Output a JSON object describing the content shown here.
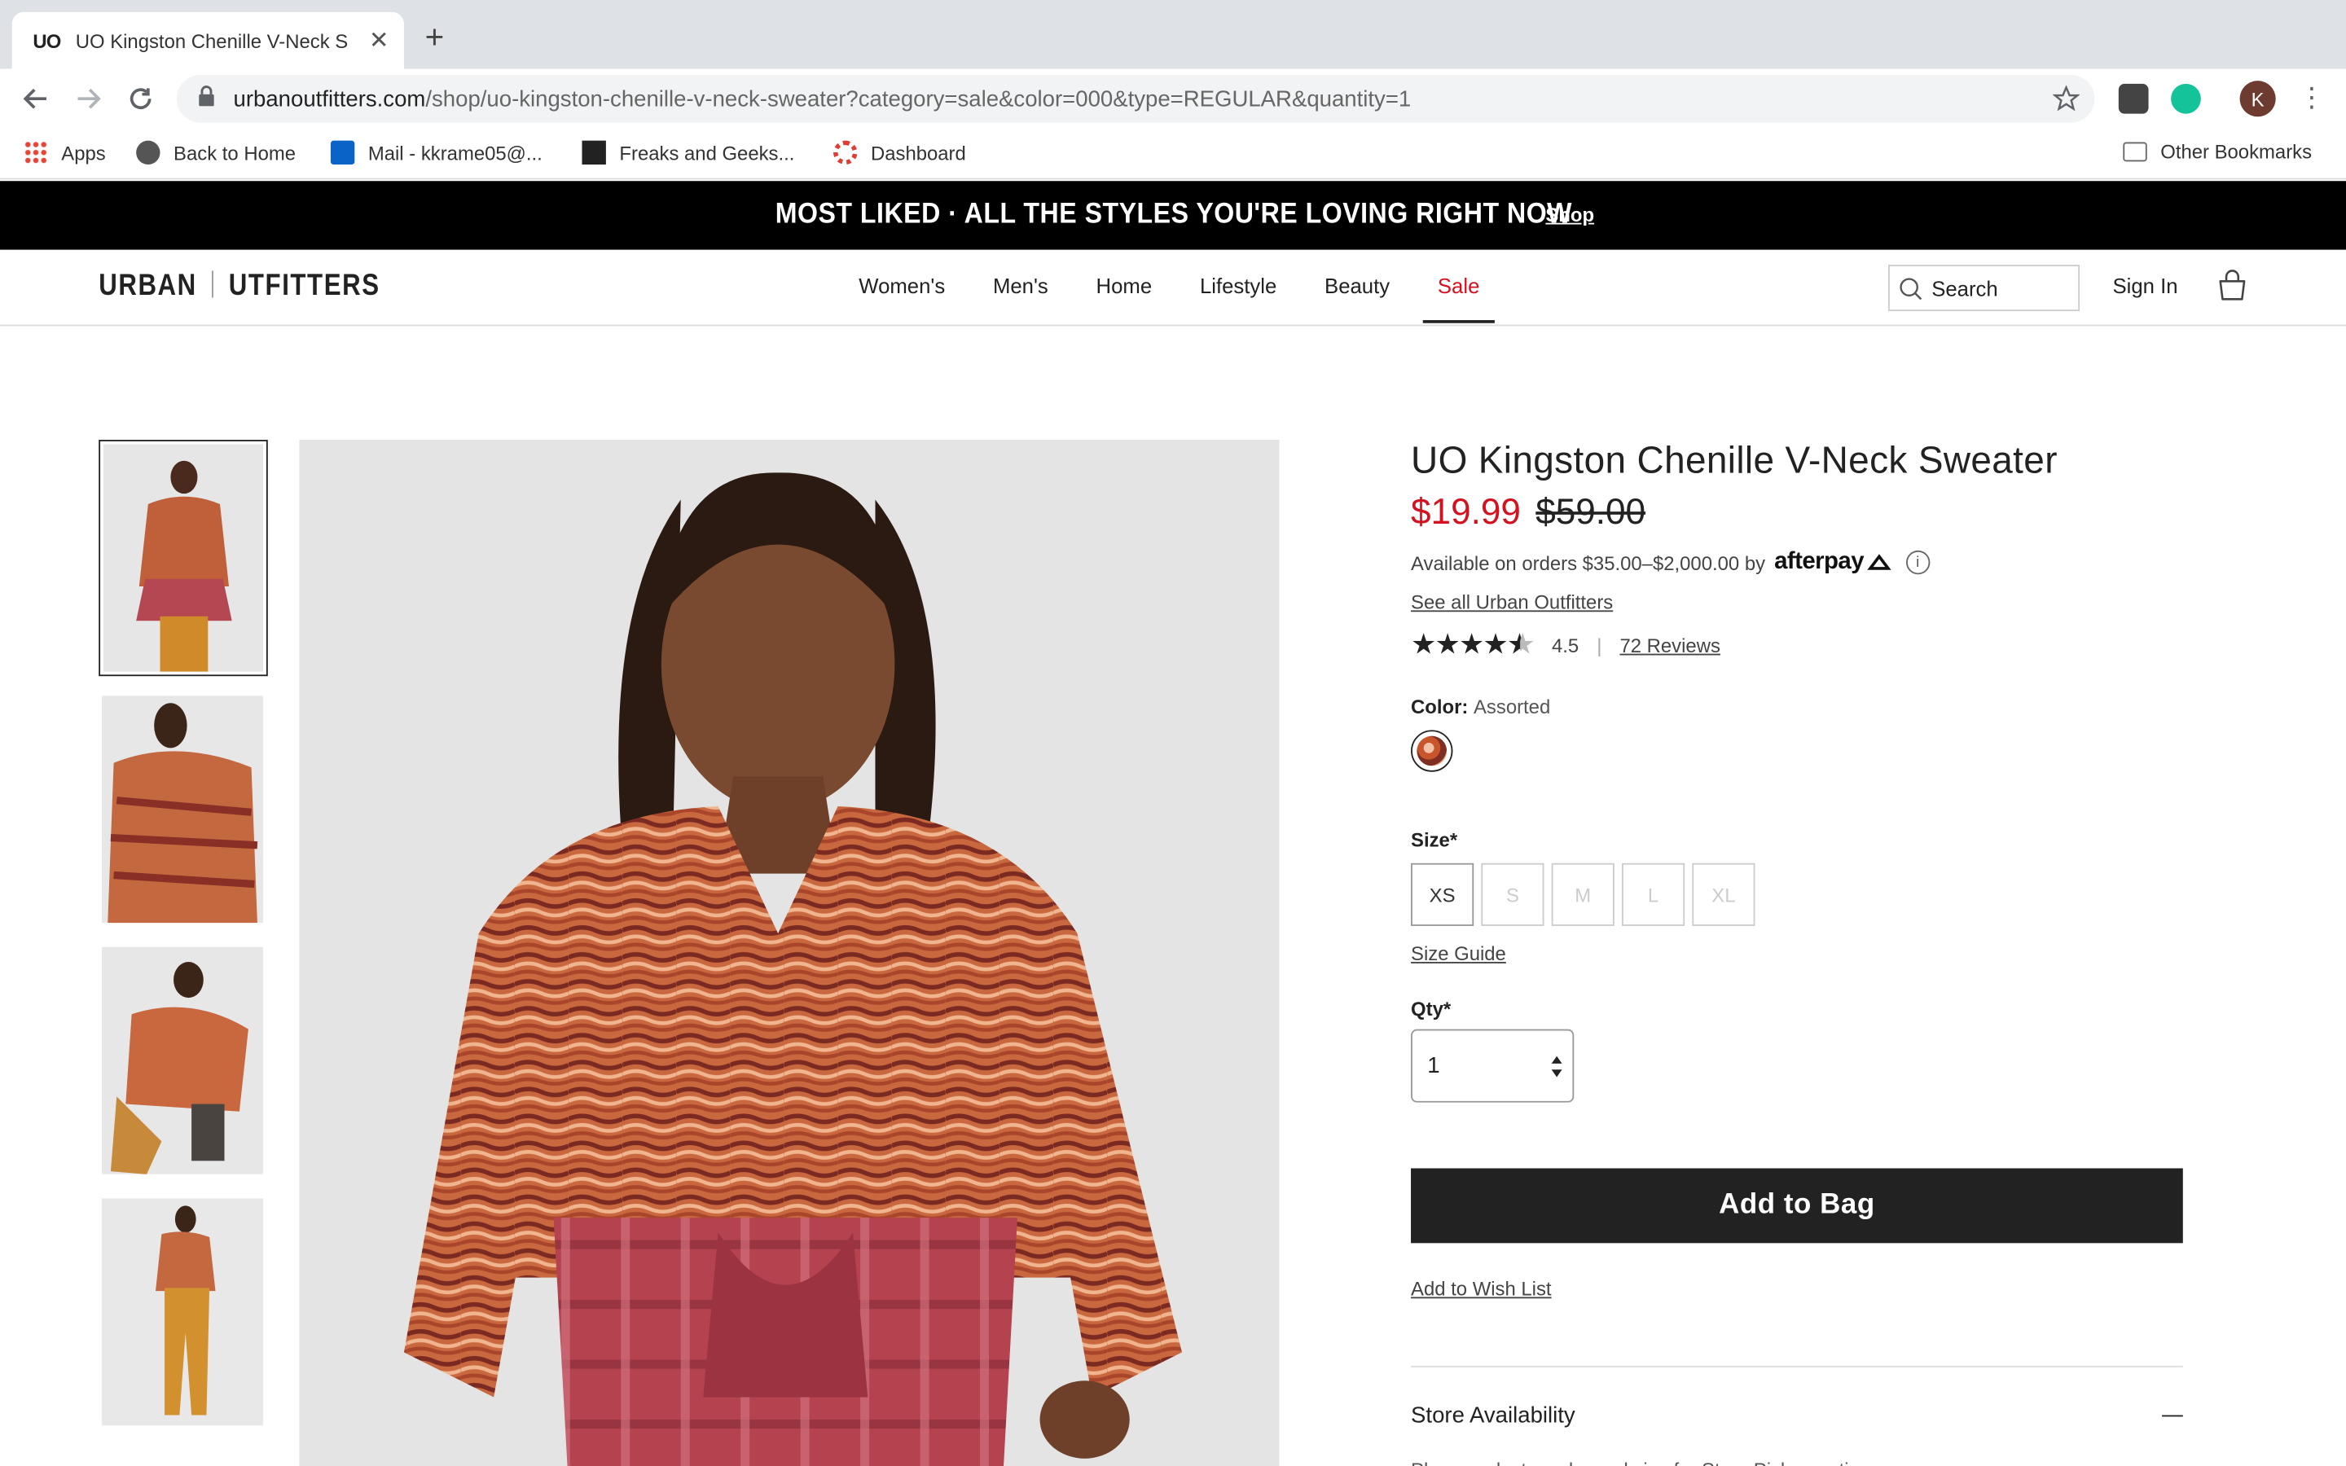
{
  "browser": {
    "tab_title": "UO Kingston Chenille V-Neck S",
    "tab_favicon": "UO",
    "url_host": "urbanoutfitters.com",
    "url_path": "/shop/uo-kingston-chenille-v-neck-sweater?category=sale&color=000&type=REGULAR&quantity=1",
    "profile_initial": "K",
    "bookmarks": [
      "Apps",
      "Back to Home",
      "Mail - kkrame05@...",
      "Freaks and Geeks...",
      "Dashboard"
    ],
    "other_bookmarks": "Other Bookmarks"
  },
  "promo": {
    "text": "MOST LIKED · ALL THE STYLES YOU'RE LOVING RIGHT NOW",
    "link": "Shop"
  },
  "nav": {
    "logo_left": "URBAN",
    "logo_right": "UTFITTERS",
    "items": [
      "Women's",
      "Men's",
      "Home",
      "Lifestyle",
      "Beauty",
      "Sale"
    ],
    "search_placeholder": "Search",
    "sign_in": "Sign In"
  },
  "product": {
    "title": "UO Kingston Chenille V-Neck Sweater",
    "price_now": "$19.99",
    "price_was": "$59.00",
    "afterpay_text": "Available on orders $35.00–$2,000.00 by",
    "afterpay_logo": "afterpay",
    "brand_link": "See all Urban Outfitters",
    "rating": "4.5",
    "reviews": "72 Reviews",
    "color_label": "Color:",
    "color_value": "Assorted",
    "size_label": "Size*",
    "sizes": [
      "XS",
      "S",
      "M",
      "L",
      "XL"
    ],
    "size_guide": "Size Guide",
    "qty_label": "Qty*",
    "qty_value": "1",
    "add_to_bag": "Add to Bag",
    "wish_list": "Add to Wish List",
    "store_availability": "Store Availability",
    "store_note": "Please select a color and size for Store Pickup options"
  },
  "colors": {
    "sale_red": "#d4111e",
    "button_dark": "#222222",
    "promo_bg": "#000000"
  }
}
